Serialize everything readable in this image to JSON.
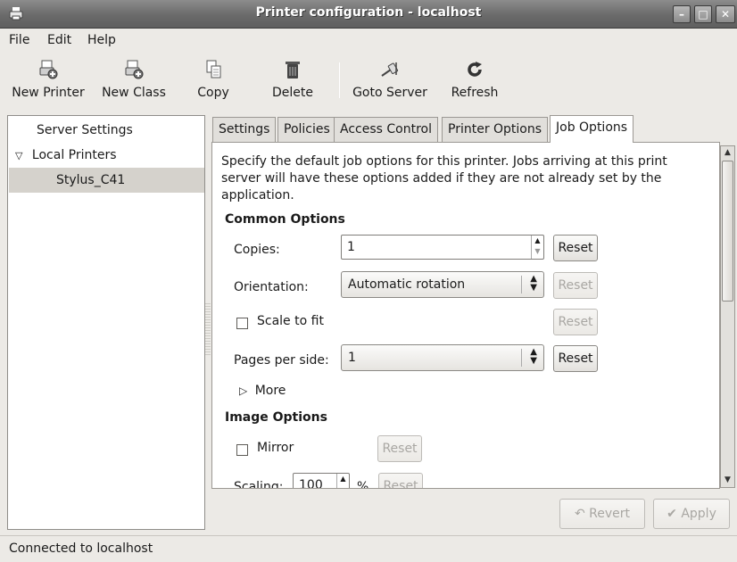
{
  "window": {
    "title": "Printer configuration - localhost"
  },
  "menu": [
    "File",
    "Edit",
    "Help"
  ],
  "toolbar": {
    "new_printer": "New Printer",
    "new_class": "New Class",
    "copy": "Copy",
    "delete": "Delete",
    "goto_server": "Goto Server",
    "refresh": "Refresh"
  },
  "sidebar": {
    "server_settings": "Server Settings",
    "local_printers": "Local Printers",
    "printer": "Stylus_C41"
  },
  "tabs": [
    "Settings",
    "Policies",
    "Access Control",
    "Printer Options",
    "Job Options"
  ],
  "job_options": {
    "description": "Specify the default job options for this printer.  Jobs arriving at this print server will have these options added if they are not already set by the application.",
    "common_title": "Common Options",
    "copies_label": "Copies:",
    "copies_value": "1",
    "orientation_label": "Orientation:",
    "orientation_value": "Automatic rotation",
    "scale_label": "Scale to fit",
    "pages_label": "Pages per side:",
    "pages_value": "1",
    "more_label": "More",
    "image_title": "Image Options",
    "mirror_label": "Mirror",
    "scaling_label": "Scaling:",
    "scaling_value": "100",
    "scaling_unit": "%",
    "reset": "Reset"
  },
  "buttons": {
    "revert": "Revert",
    "apply": "Apply"
  },
  "status": "Connected to localhost"
}
